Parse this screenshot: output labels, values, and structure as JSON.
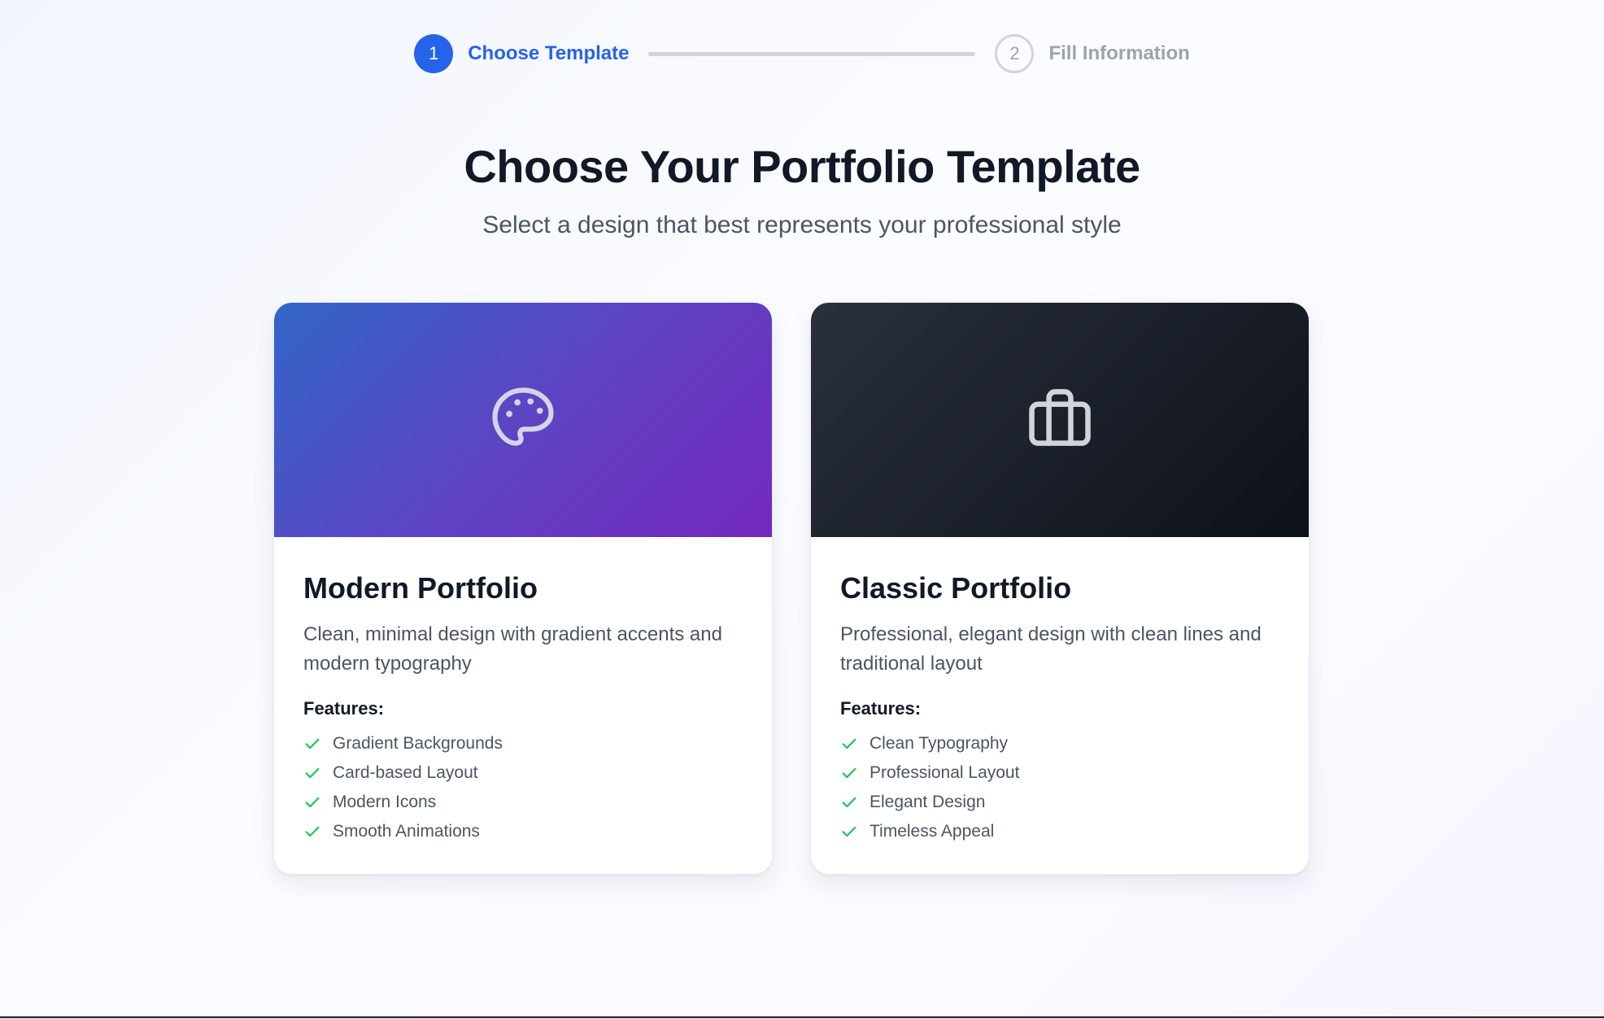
{
  "stepper": {
    "steps": [
      {
        "number": "1",
        "label": "Choose Template",
        "state": "active"
      },
      {
        "number": "2",
        "label": "Fill Information",
        "state": "inactive"
      }
    ]
  },
  "page": {
    "title": "Choose Your Portfolio Template",
    "subtitle": "Select a design that best represents your professional style"
  },
  "templates": [
    {
      "icon": "palette-icon",
      "title": "Modern Portfolio",
      "description": "Clean, minimal design with gradient accents and modern typography",
      "features_label": "Features:",
      "features": [
        "Gradient Backgrounds",
        "Card-based Layout",
        "Modern Icons",
        "Smooth Animations"
      ]
    },
    {
      "icon": "briefcase-icon",
      "title": "Classic Portfolio",
      "description": "Professional, elegant design with clean lines and traditional layout",
      "features_label": "Features:",
      "features": [
        "Clean Typography",
        "Professional Layout",
        "Elegant Design",
        "Timeless Appeal"
      ]
    }
  ],
  "colors": {
    "accent": "#2563eb",
    "check": "#22c55e",
    "modern_gradient_start": "#3165c7",
    "modern_gradient_end": "#7428bd",
    "classic_gradient_start": "#2a303c",
    "classic_gradient_end": "#0d1118"
  }
}
